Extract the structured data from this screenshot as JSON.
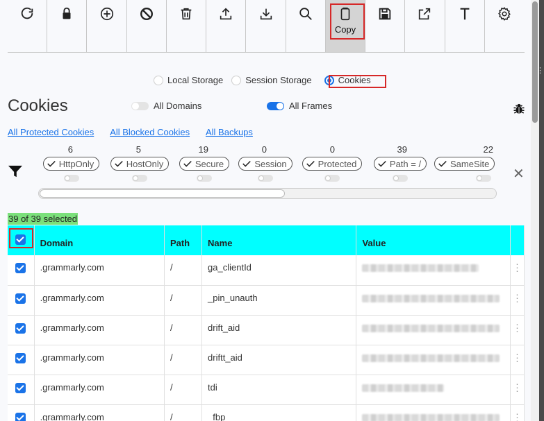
{
  "toolbar": {
    "buttons": [
      {
        "icon": "refresh-icon"
      },
      {
        "icon": "lock-icon"
      },
      {
        "icon": "add-circle-icon"
      },
      {
        "icon": "block-icon"
      },
      {
        "icon": "trash-icon"
      },
      {
        "icon": "upload-icon"
      },
      {
        "icon": "download-icon"
      },
      {
        "icon": "search-icon"
      },
      {
        "icon": "clipboard-icon",
        "label": "Copy"
      },
      {
        "icon": "save-icon"
      },
      {
        "icon": "external-link-icon"
      },
      {
        "icon": "text-icon"
      },
      {
        "icon": "gear-icon"
      }
    ]
  },
  "storage": {
    "local": "Local Storage",
    "session": "Session Storage",
    "cookies": "Cookies",
    "selected": "Cookies"
  },
  "header": {
    "title": "Cookies",
    "all_domains": "All Domains",
    "all_domains_on": false,
    "all_frames": "All Frames",
    "all_frames_on": true
  },
  "links": {
    "protected": "All Protected Cookies",
    "blocked": "All Blocked Cookies",
    "backups": "All Backups"
  },
  "filters": [
    {
      "count": "6",
      "label": "HttpOnly"
    },
    {
      "count": "5",
      "label": "HostOnly"
    },
    {
      "count": "19",
      "label": "Secure"
    },
    {
      "count": "0",
      "label": "Session"
    },
    {
      "count": "0",
      "label": "Protected"
    },
    {
      "count": "39",
      "label": "Path = /"
    },
    {
      "count": "22",
      "label": "SameSite"
    }
  ],
  "selection": "39 of 39 selected",
  "table": {
    "headers": {
      "domain": "Domain",
      "path": "Path",
      "name": "Name",
      "value": "Value"
    },
    "rows": [
      {
        "domain": ".grammarly.com",
        "path": "/",
        "name": "ga_clientId"
      },
      {
        "domain": ".grammarly.com",
        "path": "/",
        "name": "_pin_unauth"
      },
      {
        "domain": ".grammarly.com",
        "path": "/",
        "name": "drift_aid"
      },
      {
        "domain": ".grammarly.com",
        "path": "/",
        "name": "driftt_aid"
      },
      {
        "domain": ".grammarly.com",
        "path": "/",
        "name": "tdi"
      },
      {
        "domain": ".grammarly.com",
        "path": "/",
        "name": "_fbp"
      }
    ]
  },
  "colors": {
    "accent": "#1a73e8",
    "header_bg": "#00ffff",
    "selection_bg": "#7be07b",
    "highlight": "#d62828"
  }
}
